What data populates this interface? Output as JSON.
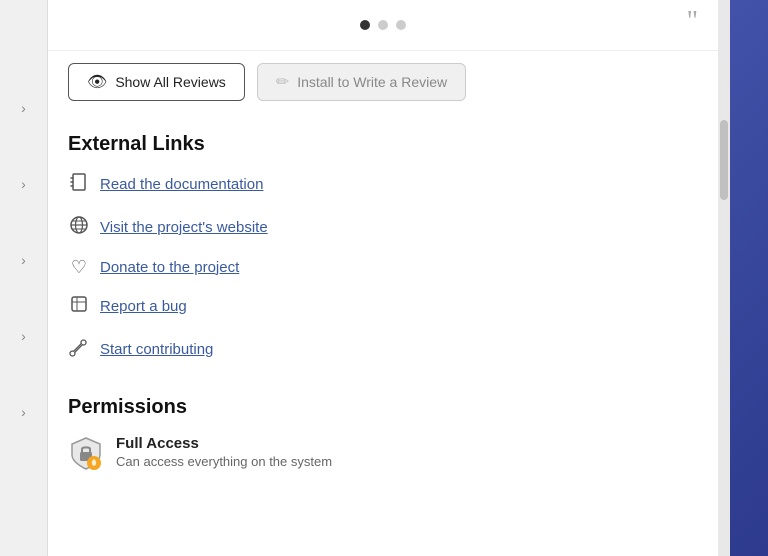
{
  "sidebar": {
    "arrows": [
      "›",
      "›",
      "›",
      "›",
      "›"
    ]
  },
  "quote_area": {
    "quote_mark": "”"
  },
  "dots": [
    {
      "active": true
    },
    {
      "active": false
    },
    {
      "active": false
    }
  ],
  "buttons": {
    "show_reviews": "Show All Reviews",
    "install_review": "Install to Write a Review",
    "show_reviews_icon": "👁",
    "install_review_icon": "✏"
  },
  "external_links": {
    "title": "External Links",
    "items": [
      {
        "icon": "📋",
        "icon_name": "documentation-icon",
        "label": "Read the documentation",
        "href": "#"
      },
      {
        "icon": "🌐",
        "icon_name": "website-icon",
        "label": "Visit the project's website",
        "href": "#"
      },
      {
        "icon": "♡",
        "icon_name": "donate-icon",
        "label": "Donate to the project",
        "href": "#"
      },
      {
        "icon": "🖼",
        "icon_name": "bug-icon",
        "label": "Report a bug",
        "href": "#"
      },
      {
        "icon": "🔧",
        "icon_name": "contribute-icon",
        "label": "Start contributing",
        "href": "#"
      }
    ]
  },
  "permissions": {
    "title": "Permissions",
    "items": [
      {
        "name": "Full Access",
        "description": "Can access everything on the system"
      }
    ]
  }
}
